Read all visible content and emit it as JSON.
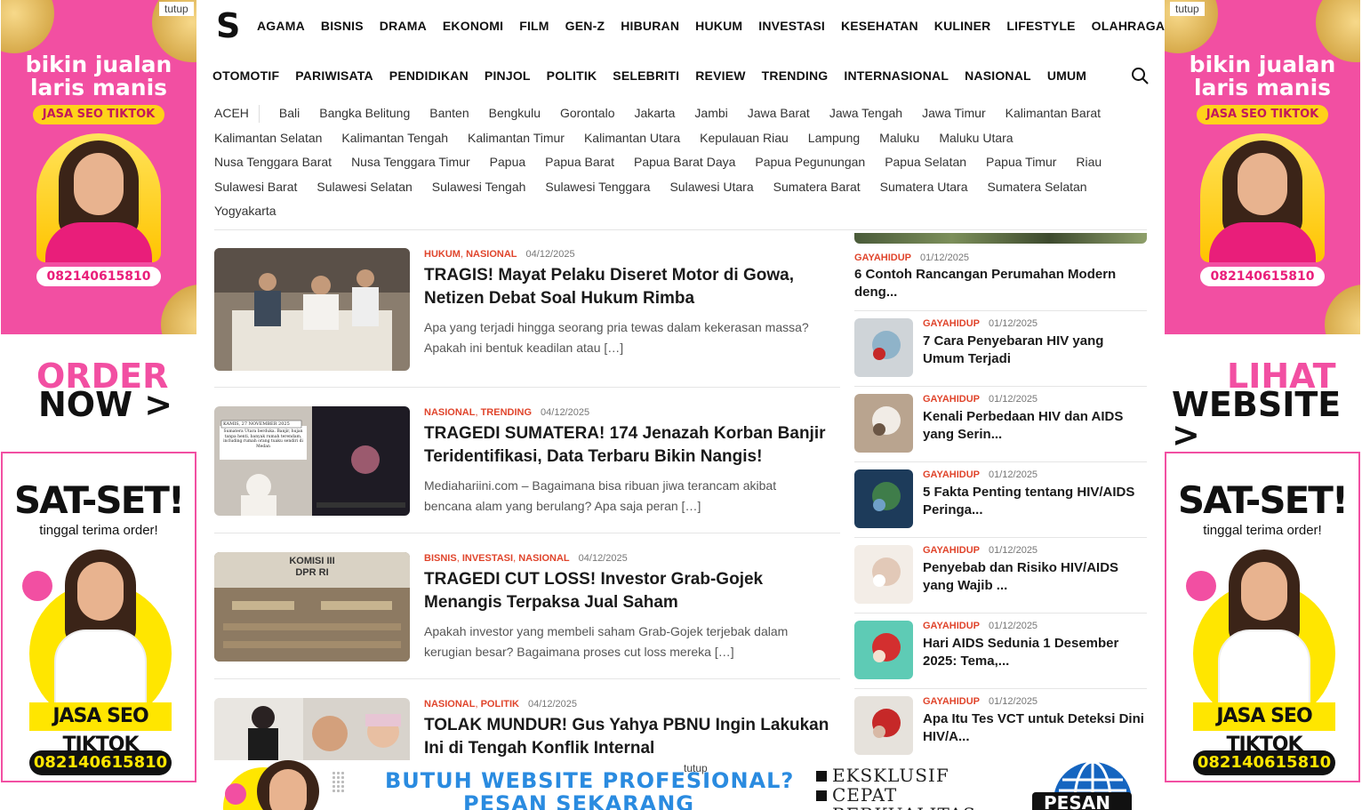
{
  "ads": {
    "close_label": "tutup",
    "side_headline": "bikin jualan laris manis",
    "side_pill": "JASA SEO TIKTOK",
    "side_phone": "082140615810",
    "left_mid_line1": "ORDER",
    "left_mid_line2": "NOW >",
    "right_mid_line1": "LIHAT",
    "right_mid_line2": "WEBSITE >",
    "sat_set": "SAT-SET!",
    "sat_sub": "tinggal terima order!",
    "seo_tag": "JASA SEO TIKTOK",
    "bottom_close": "tutup",
    "bottom_headline": "BUTUH WEBSITE PROFESIONAL?\nPESAN SEKARANG",
    "bottom_bullets": [
      "EKSKLUSIF",
      "CEPAT",
      "BERKUALITAS"
    ],
    "bottom_button": "PESAN",
    "pink": "#f24fa2",
    "yellow": "#ffe600"
  },
  "header": {
    "logo": "S",
    "nav_row1": [
      "AGAMA",
      "BISNIS",
      "DRAMA",
      "EKONOMI",
      "FILM",
      "GEN-Z",
      "HIBURAN",
      "HUKUM",
      "INVESTASI",
      "KESEHATAN",
      "KULINER",
      "LIFESTYLE",
      "OLAHRAGA"
    ],
    "nav_row2": [
      "OTOMOTIF",
      "PARIWISATA",
      "PENDIDIKAN",
      "PINJOL",
      "POLITIK",
      "SELEBRITI",
      "REVIEW",
      "TRENDING",
      "INTERNASIONAL",
      "NASIONAL",
      "UMUM"
    ],
    "search_icon": "search-icon"
  },
  "regions": [
    "ACEH",
    "Bali",
    "Bangka Belitung",
    "Banten",
    "Bengkulu",
    "Gorontalo",
    "Jakarta",
    "Jambi",
    "Jawa Barat",
    "Jawa Tengah",
    "Jawa Timur",
    "Kalimantan Barat",
    "Kalimantan Selatan",
    "Kalimantan Tengah",
    "Kalimantan Timur",
    "Kalimantan Utara",
    "Kepulauan Riau",
    "Lampung",
    "Maluku",
    "Maluku Utara",
    "Nusa Tenggara Barat",
    "Nusa Tenggara Timur",
    "Papua",
    "Papua Barat",
    "Papua Barat Daya",
    "Papua Pegunungan",
    "Papua Selatan",
    "Papua Timur",
    "Riau",
    "Sulawesi Barat",
    "Sulawesi Selatan",
    "Sulawesi Tengah",
    "Sulawesi Tenggara",
    "Sulawesi Utara",
    "Sumatera Barat",
    "Sumatera Utara",
    "Sumatera Selatan",
    "Yogyakarta"
  ],
  "articles": [
    {
      "categories": [
        "HUKUM",
        "NASIONAL"
      ],
      "date": "04/12/2025",
      "title": "TRAGIS! Mayat Pelaku Diseret Motor di Gowa, Netizen Debat Soal Hukum Rimba",
      "excerpt": "Apa yang terjadi hingga seorang pria tewas dalam kekerasan massa? Apakah ini bentuk keadilan atau […]"
    },
    {
      "categories": [
        "NASIONAL",
        "TRENDING"
      ],
      "date": "04/12/2025",
      "title": "TRAGEDI SUMATERA! 174 Jenazah Korban Banjir Teridentifikasi, Data Terbaru Bikin Nangis!",
      "excerpt": "Mediahariini.com – Bagaimana bisa ribuan jiwa terancam akibat bencana alam yang berulang? Apa saja peran […]",
      "thumb_caption": "KAMIS, 27 NOVEMBER 2025",
      "thumb_text": "Sumatera Utara berduka. Banjir, hujan tanpa henti, banyak rumah terendam, including rumah orang tuaku sendiri di Medan"
    },
    {
      "categories": [
        "BISNIS",
        "INVESTASI",
        "NASIONAL"
      ],
      "date": "04/12/2025",
      "title": "TRAGEDI CUT LOSS! Investor Grab-Gojek Menangis Terpaksa Jual Saham",
      "excerpt": "Apakah investor yang membeli saham Grab-Gojek terjebak dalam kerugian besar? Bagaimana proses cut loss mereka […]",
      "thumb_caption": "KOMISI III DPR RI"
    },
    {
      "categories": [
        "NASIONAL",
        "POLITIK"
      ],
      "date": "04/12/2025",
      "title": "TOLAK MUNDUR! Gus Yahya PBNU Ingin Lakukan Ini di Tengah Konflik Internal",
      "excerpt": ""
    }
  ],
  "sidebar": {
    "first": {
      "category": "GAYAHIDUP",
      "date": "01/12/2025",
      "title": "6 Contoh Rancangan Perumahan Modern deng..."
    },
    "items": [
      {
        "category": "GAYAHIDUP",
        "date": "01/12/2025",
        "title": "7 Cara Penyebaran HIV yang Umum Terjadi"
      },
      {
        "category": "GAYAHIDUP",
        "date": "01/12/2025",
        "title": "Kenali Perbedaan HIV dan AIDS yang Serin..."
      },
      {
        "category": "GAYAHIDUP",
        "date": "01/12/2025",
        "title": "5 Fakta Penting tentang HIV/AIDS Peringa..."
      },
      {
        "category": "GAYAHIDUP",
        "date": "01/12/2025",
        "title": "Penyebab dan Risiko HIV/AIDS yang Wajib ..."
      },
      {
        "category": "GAYAHIDUP",
        "date": "01/12/2025",
        "title": "Hari AIDS Sedunia 1 Desember 2025: Tema,..."
      },
      {
        "category": "GAYAHIDUP",
        "date": "01/12/2025",
        "title": "Apa Itu Tes VCT untuk Deteksi Dini HIV/A..."
      }
    ]
  },
  "colors": {
    "accent": "#e0452c",
    "text": "#1a1a1a"
  }
}
